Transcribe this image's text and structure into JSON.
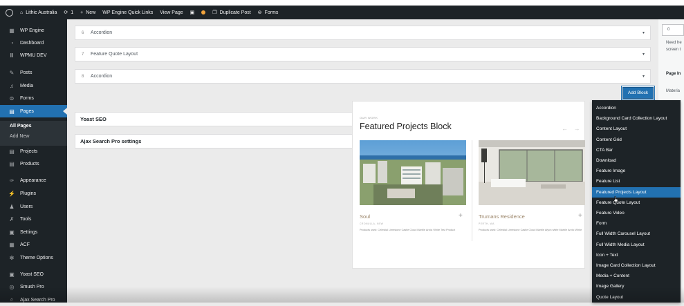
{
  "adminbar": {
    "site_name": "Lithic Australia",
    "updates_count": "1",
    "new_label": "New",
    "quick_links": "WP Engine Quick Links",
    "view_page": "View Page",
    "duplicate_post": "Duplicate Post",
    "forms": "Forms"
  },
  "sidebar": {
    "items": [
      {
        "label": "WP Engine",
        "icon": "wpengine-icon"
      },
      {
        "label": "Dashboard",
        "icon": "dashboard-icon"
      },
      {
        "label": "WPMU DEV",
        "icon": "wpmudev-icon"
      },
      {
        "label": "Posts",
        "icon": "pin-icon"
      },
      {
        "label": "Media",
        "icon": "media-icon"
      },
      {
        "label": "Forms",
        "icon": "forms-icon"
      },
      {
        "label": "Pages",
        "icon": "pages-icon"
      },
      {
        "label": "Projects",
        "icon": "projects-icon"
      },
      {
        "label": "Products",
        "icon": "products-icon"
      },
      {
        "label": "Appearance",
        "icon": "brush-icon"
      },
      {
        "label": "Plugins",
        "icon": "plug-icon"
      },
      {
        "label": "Users",
        "icon": "users-icon"
      },
      {
        "label": "Tools",
        "icon": "wrench-icon"
      },
      {
        "label": "Settings",
        "icon": "settings-icon"
      },
      {
        "label": "ACF",
        "icon": "acf-icon"
      },
      {
        "label": "Theme Options",
        "icon": "gear-icon"
      },
      {
        "label": "Yoast SEO",
        "icon": "yoast-icon"
      },
      {
        "label": "Smush Pro",
        "icon": "smush-icon"
      },
      {
        "label": "Ajax Search Pro",
        "icon": "search-icon"
      }
    ],
    "submenu": [
      "All Pages",
      "Add New"
    ]
  },
  "layouts": [
    {
      "num": "6",
      "label": "Accordion"
    },
    {
      "num": "7",
      "label": "Feature Quote Layout"
    },
    {
      "num": "8",
      "label": "Accordion"
    }
  ],
  "add_block_label": "Add Block",
  "postboxes": [
    "Yoast SEO",
    "Ajax Search Pro settings"
  ],
  "preview": {
    "eyebrow": "OUR WORK",
    "title": "Featured Projects Block",
    "arrows": "← →",
    "cards": [
      {
        "name": "Soul",
        "location": "CRONULLA, NSW",
        "products": "Products used: Celestial Limestone Castle Cloud Marble Arctic White Test Product"
      },
      {
        "name": "Trumans Residence",
        "location": "PERTH, WA",
        "products": "Products used: Celestial Limestone Castle Cloud Marble Afyon white Marble Arctic White"
      }
    ]
  },
  "dropdown": {
    "items": [
      "Accordion",
      "Background Card Collection Layout",
      "Content Layout",
      "Content Grid",
      "CTA Bar",
      "Download",
      "Feature Image",
      "Feature List",
      "Featured Projects Layout",
      "Feature Quote Layout",
      "Feature Video",
      "Form",
      "Full Width Carousel Layout",
      "Full Width Media Layout",
      "Icon + Text",
      "Image Card Collection Layout",
      "Media + Content",
      "Image Gallery",
      "Quote Layout"
    ],
    "highlighted": "Featured Projects Layout"
  },
  "right_panel": {
    "order_value": "0",
    "need_help_1": "Need he",
    "need_help_2": "screen t",
    "page_heading": "Page In",
    "material": "Materia"
  },
  "colors": {
    "admin_dark": "#1d2327",
    "accent_blue": "#2271b1",
    "background": "#ebebeb"
  }
}
